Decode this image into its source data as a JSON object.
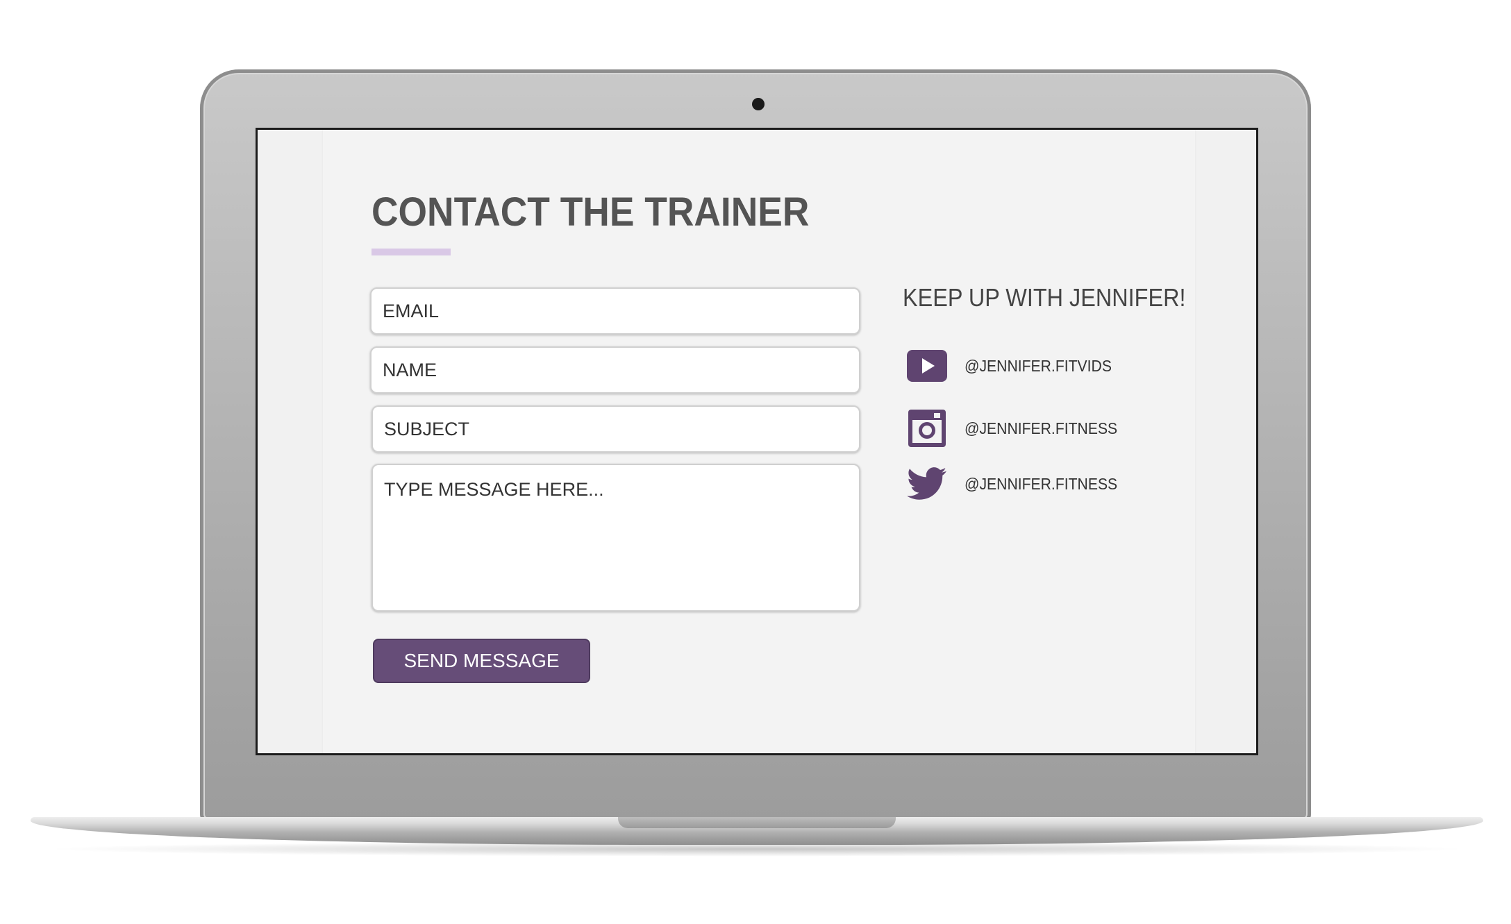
{
  "page": {
    "title": "CONTACT THE TRAINER",
    "accent_color": "#664d78",
    "underline_color": "#d9c8e6"
  },
  "form": {
    "email_placeholder": "EMAIL",
    "name_placeholder": "NAME",
    "subject_placeholder": "SUBJECT",
    "message_placeholder": "TYPE MESSAGE HERE...",
    "submit_label": "SEND MESSAGE"
  },
  "social": {
    "heading": "KEEP UP WITH JENNIFER!",
    "items": [
      {
        "icon": "youtube-icon",
        "handle": "@JENNIFER.FITVIDS"
      },
      {
        "icon": "instagram-icon",
        "handle": "@JENNIFER.FITNESS"
      },
      {
        "icon": "twitter-icon",
        "handle": "@JENNIFER.FITNESS"
      }
    ]
  }
}
